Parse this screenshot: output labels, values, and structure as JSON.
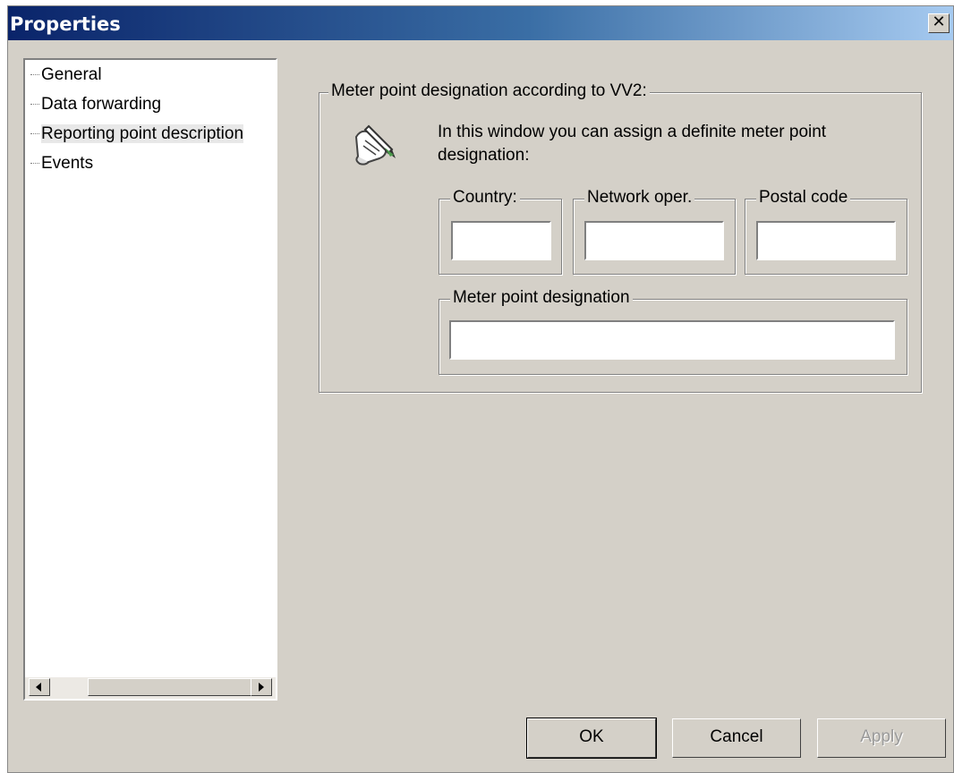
{
  "window": {
    "title": "Properties",
    "close_label": "✕"
  },
  "tree": {
    "items": [
      {
        "label": "General"
      },
      {
        "label": "Data forwarding"
      },
      {
        "label": "Reporting point description"
      },
      {
        "label": "Events"
      }
    ],
    "selected_index": 2
  },
  "group": {
    "legend": "Meter point designation according to VV2:",
    "description": "In this window you can assign a definite meter point designation:",
    "icon": "pen-and-scroll-icon",
    "fields": {
      "country": {
        "label": "Country:",
        "value": ""
      },
      "network": {
        "label": "Network oper.",
        "value": ""
      },
      "postal": {
        "label": "Postal code",
        "value": ""
      },
      "meter_point": {
        "label": "Meter point designation",
        "value": ""
      }
    }
  },
  "buttons": {
    "ok": "OK",
    "cancel": "Cancel",
    "apply": "Apply"
  }
}
